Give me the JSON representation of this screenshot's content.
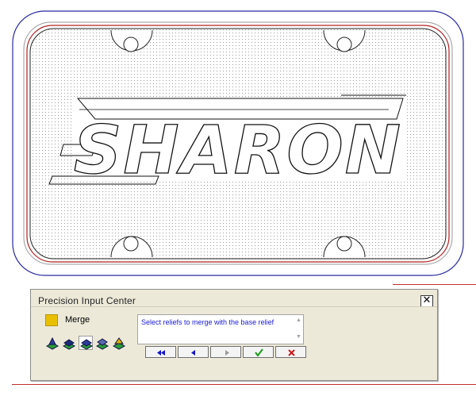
{
  "window": {
    "title": "Precision Input Center",
    "close_label": "✕"
  },
  "merge": {
    "label": "Merge",
    "swatch_color": "#e8c000"
  },
  "prompt": {
    "text": "Select reliefs to merge with the base relief"
  },
  "tools": [
    {
      "icon": "relief-add-icon",
      "selected": false
    },
    {
      "icon": "relief-merge-high-icon",
      "selected": false
    },
    {
      "icon": "relief-merge-low-icon",
      "selected": true
    },
    {
      "icon": "relief-subtract-icon",
      "selected": false
    },
    {
      "icon": "relief-multiply-icon",
      "selected": false
    }
  ],
  "nav_buttons": [
    {
      "icon": "rewind-icon",
      "enabled": true
    },
    {
      "icon": "back-icon",
      "enabled": true
    },
    {
      "icon": "forward-icon",
      "enabled": false
    },
    {
      "icon": "accept-checkmark-icon",
      "enabled": true
    },
    {
      "icon": "cancel-x-icon",
      "enabled": true
    }
  ],
  "drawing": {
    "plate_text": "SHARON",
    "outer_boundary_color": "#2a2aa0",
    "inner_boundary_color": "#b02020"
  }
}
